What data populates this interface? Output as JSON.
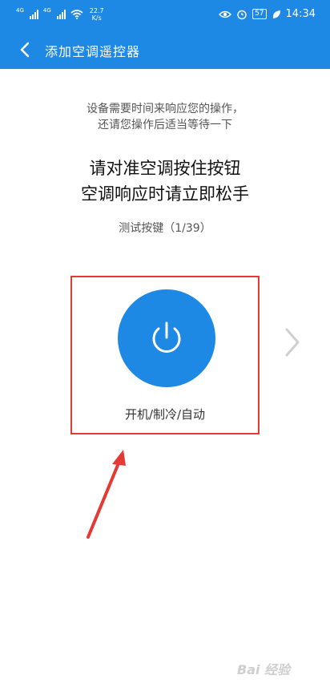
{
  "status_bar": {
    "sim1_tag": "4G",
    "sim2_tag": "4G",
    "speed_value": "22.7",
    "speed_unit": "K/s",
    "battery": "57",
    "time": "14:34"
  },
  "app_bar": {
    "title": "添加空调遥控器"
  },
  "content": {
    "hint_line1": "设备需要时间来响应您的操作，",
    "hint_line2": "还请您操作后适当等待一下",
    "instruction_line1": "请对准空调按住按钮",
    "instruction_line2": "空调响应时请立即松手",
    "progress_text": "测试按键（1/39）",
    "power_button_label": "开机/制冷/自动"
  },
  "watermark": "Bai 经验",
  "colors": {
    "primary": "#1e88e5",
    "annotation": "#e53935"
  }
}
